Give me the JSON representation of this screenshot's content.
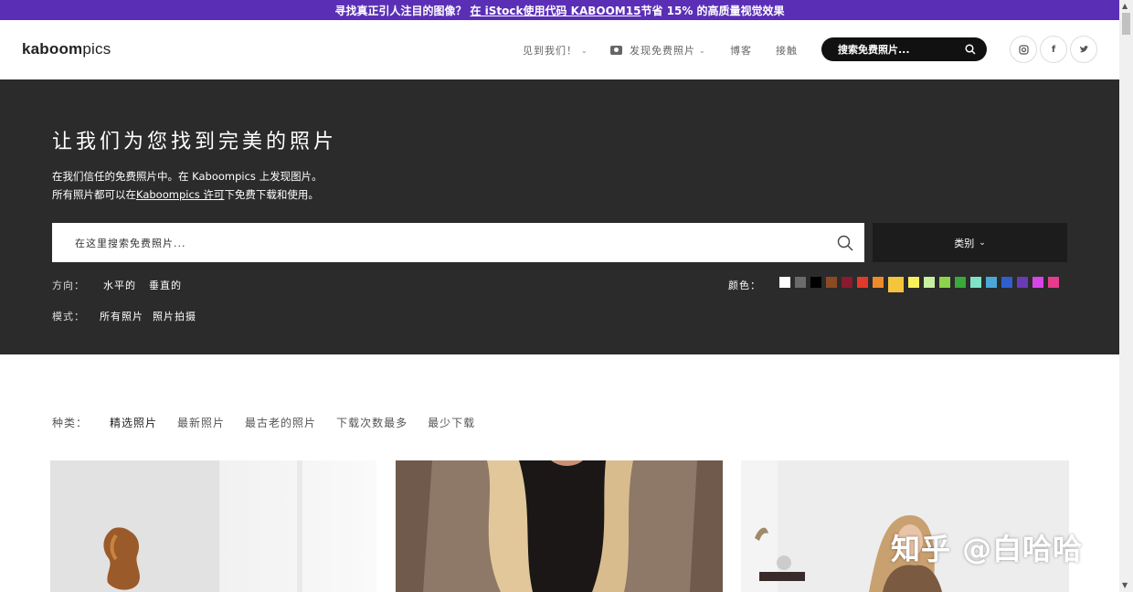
{
  "promo": {
    "prefix": "寻找真正引人注目的图像？",
    "link": "在 iStock使用代码 KABOOM15",
    "suffix": "节省 15% 的高质量视觉效果"
  },
  "header": {
    "logo_bold": "kaboom",
    "logo_rest": "pics",
    "nav": [
      "见到我们！",
      "发现免费照片",
      "博客",
      "接触"
    ],
    "search_label": "搜索免费照片...",
    "social": [
      "instagram",
      "facebook",
      "twitter"
    ]
  },
  "hero": {
    "title": "让我们为您找到完美的照片",
    "desc_line1": "在我们信任的免费照片中。在 Kaboompics 上发现图片。",
    "desc_line2_pre": "所有照片都可以在",
    "desc_line2_link": "Kaboompics 许可",
    "desc_line2_post": "下免费下载和使用。",
    "search_placeholder": "在这里搜索免费照片...",
    "category_label": "类别",
    "orientation_label": "方向：",
    "orientation": [
      "水平的",
      "垂直的"
    ],
    "mode_label": "模式：",
    "modes": [
      "所有照片",
      "照片拍摄"
    ],
    "color_label": "颜色：",
    "colors": [
      "#ffffff",
      "#6b6b6b",
      "#000000",
      "#8b4a24",
      "#8a1a2e",
      "#e23a2a",
      "#ee8a2a",
      "#f3c43c",
      "#f7f05a",
      "#c7f0a0",
      "#8cd44a",
      "#3aa83a",
      "#7ee2c8",
      "#4aa8d8",
      "#2f5fcf",
      "#6a3ab8",
      "#d844e8",
      "#e83a8e"
    ]
  },
  "sort": {
    "label": "种类：",
    "items": [
      "精选照片",
      "最新照片",
      "最古老的照片",
      "下载次数最多",
      "最少下载"
    ]
  },
  "watermark": "知乎 @白哈哈"
}
